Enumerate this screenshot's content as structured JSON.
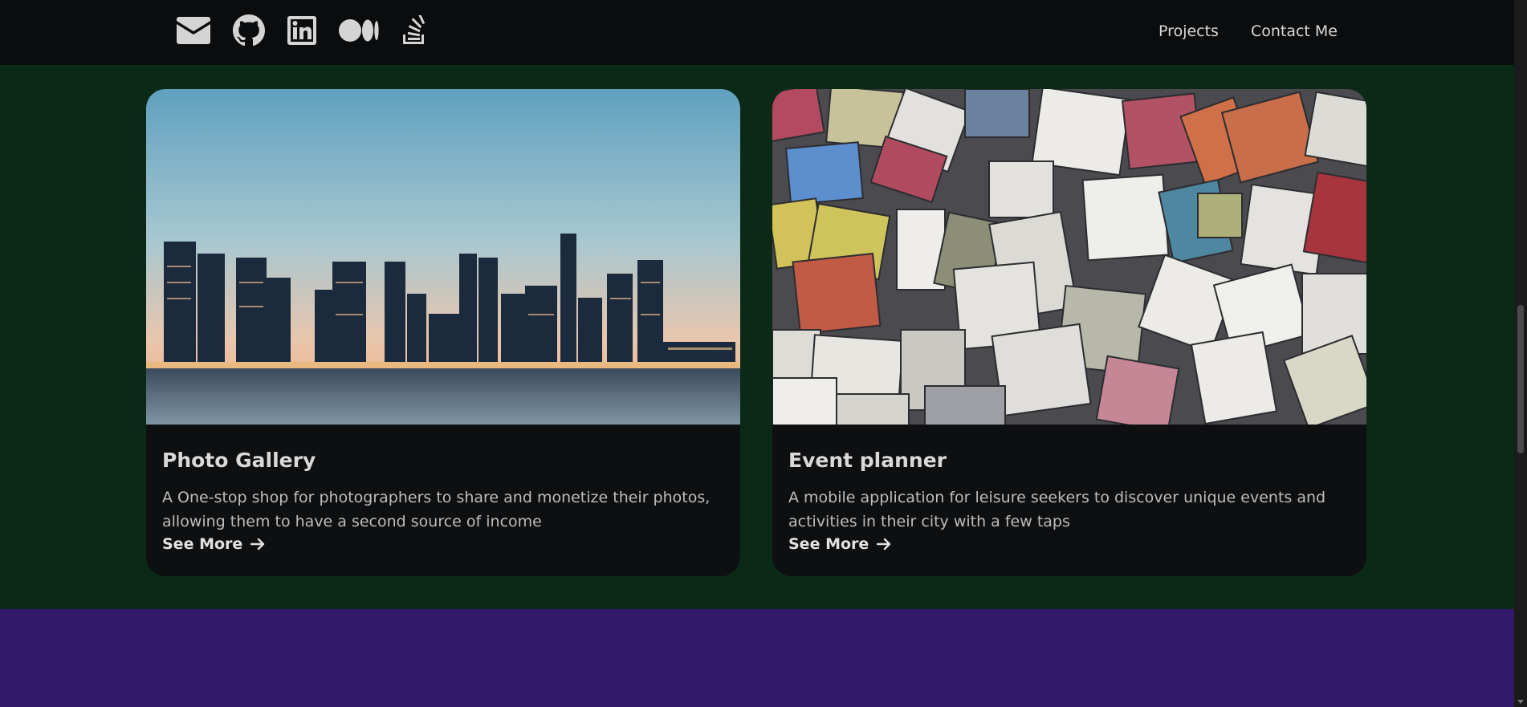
{
  "nav": {
    "social_icons": [
      "mail-icon",
      "github-icon",
      "linkedin-icon",
      "medium-icon",
      "stackoverflow-icon"
    ],
    "links": [
      "Projects",
      "Contact Me"
    ]
  },
  "projects": [
    {
      "title": "Photo Gallery",
      "description": "A One-stop shop for photographers to share and monetize their photos, allowing them to have a second source of income",
      "link": "See More",
      "image": "city-skyline-photo"
    },
    {
      "title": "Event planner",
      "description": "A mobile application for leisure seekers to discover unique events and activities in their city with a few taps",
      "link": "See More",
      "image": "colorful-chalk-blocks-photo"
    }
  ],
  "colors": {
    "navbar": "#0b0c0e",
    "projects_section": "#0a2a17",
    "card": "#0e0f11",
    "next_section": "#33196a"
  }
}
